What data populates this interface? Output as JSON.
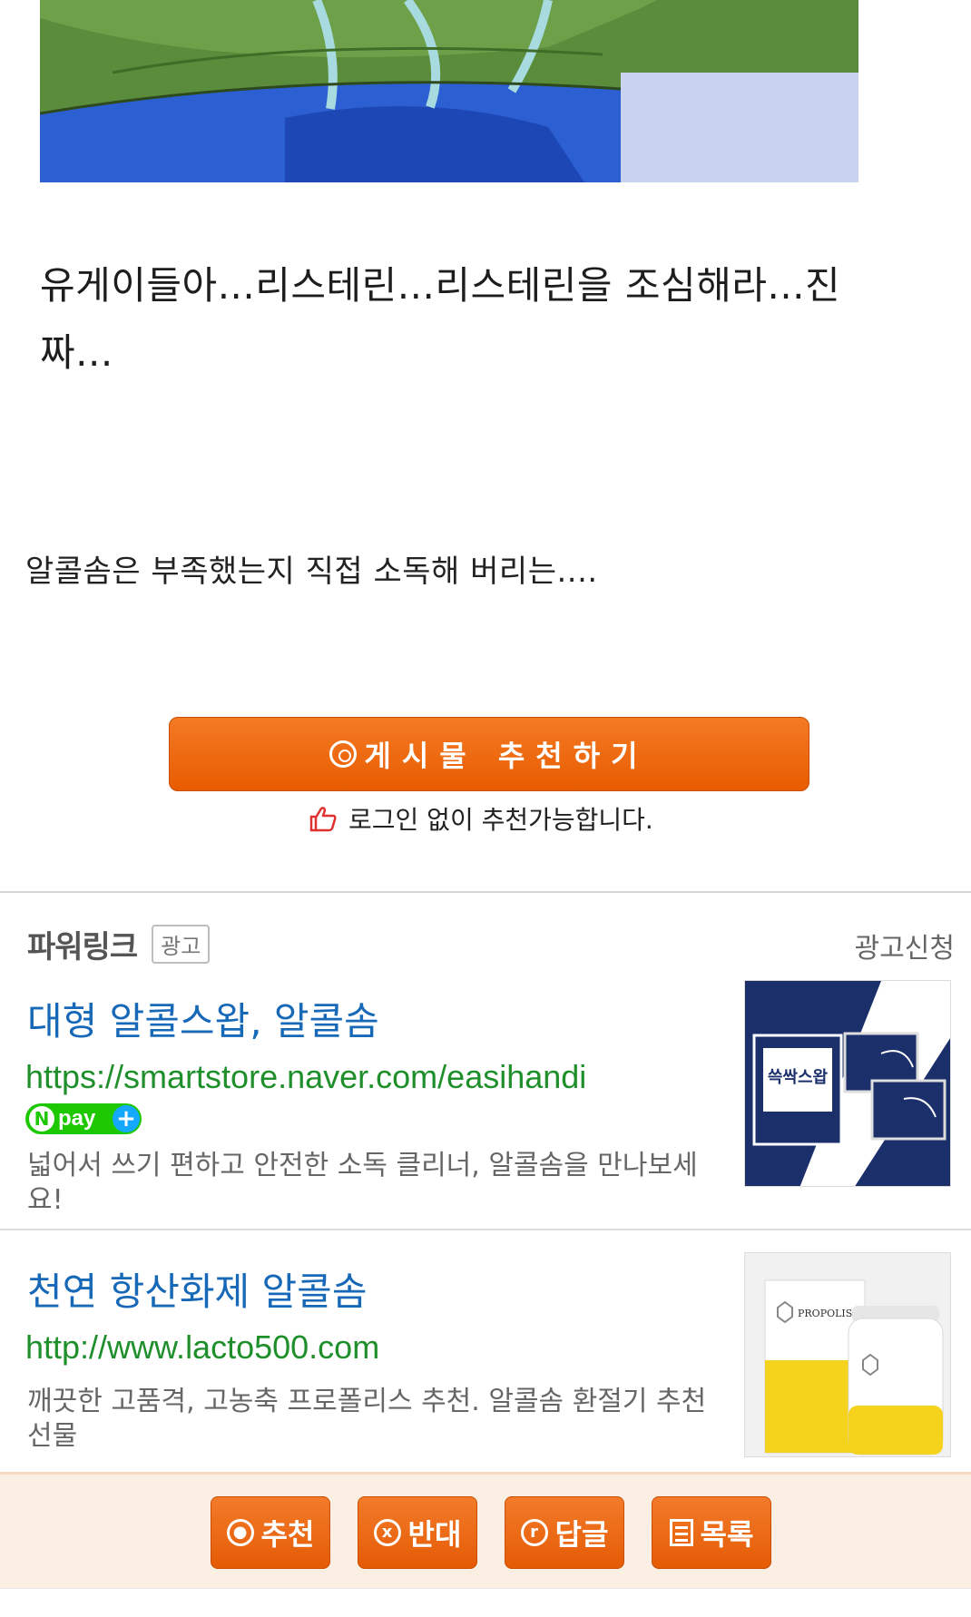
{
  "post": {
    "title": "유게이들아...리스테린...리스테린을 조심해라...진짜...",
    "body": "알콜솜은 부족했는지 직접 소독해 버리는...."
  },
  "recommend": {
    "button_label": "게시물 추천하기",
    "note": "로그인 없이 추천가능합니다."
  },
  "powerlink": {
    "title": "파워링크",
    "badge": "광고",
    "apply": "광고신청",
    "ads": [
      {
        "title": "대형 알콜스왑, 알콜솜",
        "url": "https://smartstore.naver.com/easihandi",
        "npay_label": "pay",
        "description": "넓어서 쓰기 편하고 안전한 소독 클리너, 알콜솜을 만나보세요!",
        "thumb_text": "쓱싹스왑"
      },
      {
        "title": "천연 항산화제 알콜솜",
        "url": "http://www.lacto500.com",
        "description": "깨끗한 고품격, 고농축 프로폴리스 추천. 알콜솜 환절기 추천 선물",
        "thumb_text": "PROPOLIS"
      }
    ]
  },
  "bottom_bar": {
    "recommend": "추천",
    "oppose": "반대",
    "reply": "답글",
    "list": "목록"
  },
  "colors": {
    "accent_orange": "#e85c00",
    "link_blue": "#1769b8",
    "url_green": "#1e8f2b",
    "npay_green": "#1ec800"
  }
}
